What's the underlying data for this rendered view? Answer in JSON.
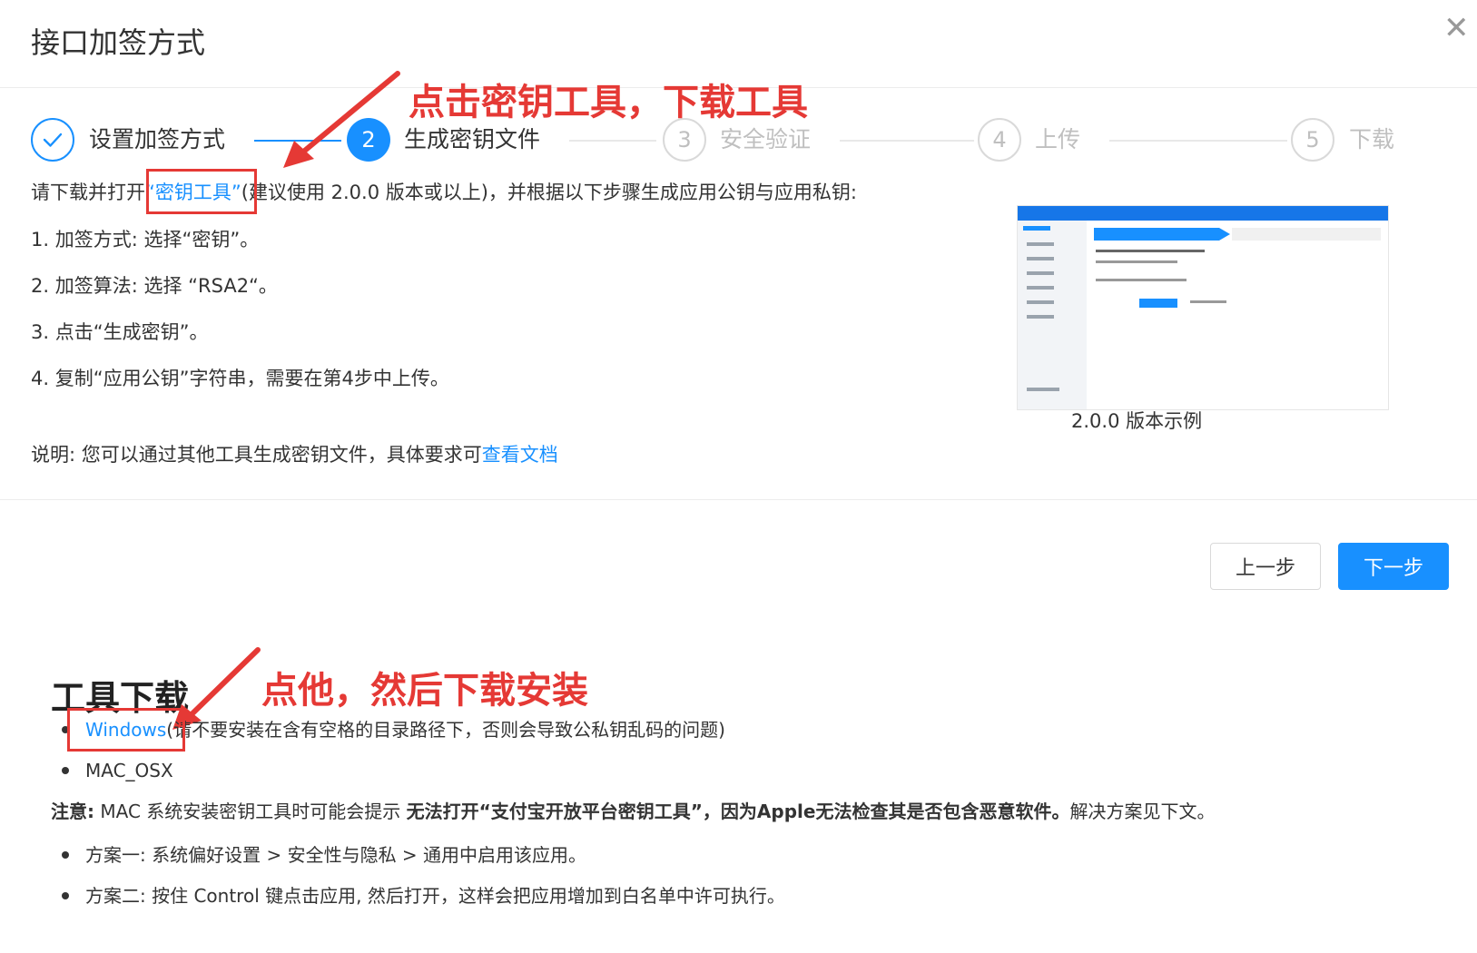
{
  "dialog": {
    "title": "接口加签方式"
  },
  "steps": [
    {
      "number": "",
      "label": "设置加签方式",
      "state": "done"
    },
    {
      "number": "2",
      "label": "生成密钥文件",
      "state": "active"
    },
    {
      "number": "3",
      "label": "安全验证",
      "state": "wait"
    },
    {
      "number": "4",
      "label": "上传",
      "state": "wait"
    },
    {
      "number": "5",
      "label": "下载",
      "state": "wait"
    }
  ],
  "instructions": {
    "intro_prefix": "请下载并打开",
    "intro_link": "“密钥工具”",
    "intro_suffix": "(建议使用 2.0.0 版本或以上)，并根据以下步骤生成应用公钥与应用私钥:",
    "items": [
      "1. 加签方式: 选择“密钥”。",
      "2. 加签算法: 选择 “RSA2“。",
      "3. 点击“生成密钥”。",
      "4. 复制“应用公钥”字符串，需要在第4步中上传。"
    ],
    "note_prefix": "说明: 您可以通过其他工具生成密钥文件，具体要求可",
    "note_link": "查看文档"
  },
  "example_image": {
    "caption": "2.0.0 版本示例"
  },
  "annotations": {
    "top": "点击密钥工具，下载工具",
    "bottom": "点他，然后下载安装"
  },
  "buttons": {
    "prev": "上一步",
    "next": "下一步"
  },
  "download_section": {
    "heading": "工具下载",
    "windows_link": "Windows",
    "windows_note": "(请不要安装在含有空格的目录路径下，否则会导致公私钥乱码的问题)",
    "mac_link": "MAC_OSX",
    "notice_label": "注意:",
    "notice_text": "MAC 系统安装密钥工具时可能会提示",
    "notice_bold": "无法打开“支付宝开放平台密钥工具”，因为Apple无法检查其是否包含恶意软件。",
    "notice_tail": "解决方案见下文。",
    "solutions": [
      "方案一: 系统偏好设置 > 安全性与隐私 > 通用中启用该应用。",
      "方案二: 按住 Control 键点击应用, 然后打开，这样会把应用增加到白名单中许可执行。"
    ]
  },
  "colors": {
    "primary": "#1890ff",
    "annotation_red": "#e53935",
    "wait_gray": "#bfbfbf"
  }
}
